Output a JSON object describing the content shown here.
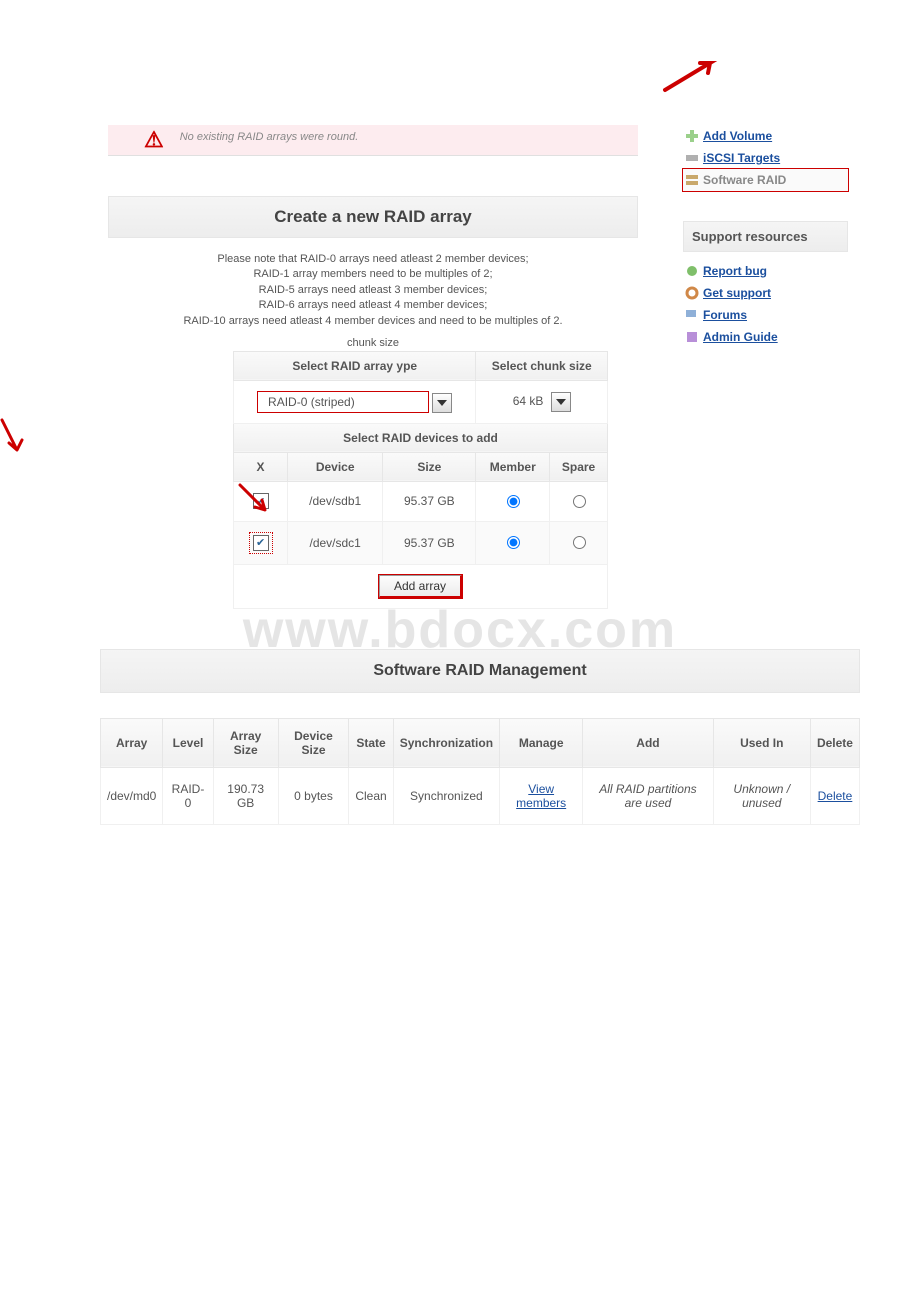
{
  "warning": {
    "message": "No existing RAID arrays were round."
  },
  "create": {
    "title": "Create a new RAID array",
    "help_lines": [
      "Please note that RAID-0 arrays need atleast 2 member devices;",
      "RAID-1 array members need to be multiples of 2;",
      "RAID-5 arrays need atleast 3 member devices;",
      "RAID-6 arrays need atleast 4 member devices;",
      "RAID-10 arrays need atleast 4 member devices and need to be multiples of 2."
    ],
    "chunk_hint": "chunk size",
    "headers": {
      "raid_type": "Select RAID array   ype",
      "chunk": "Select chunk size",
      "devices_section": "Select RAID devices to add",
      "x": "X",
      "device": "Device",
      "size": "Size",
      "member": "Member",
      "spare": "Spare"
    },
    "raid_type_value": "RAID-0 (striped)",
    "chunk_value": "64 kB",
    "devices": [
      {
        "name": "/dev/sdb1",
        "size": "95.37 GB",
        "member": true,
        "spare": false,
        "checked": true
      },
      {
        "name": "/dev/sdc1",
        "size": "95.37 GB",
        "member": true,
        "spare": false,
        "checked": true
      }
    ],
    "add_button": "Add array"
  },
  "nav": {
    "items": [
      "Add Volume",
      "iSCSI Targets",
      "Software RAID"
    ]
  },
  "support": {
    "title": "Support resources",
    "items": [
      "Report bug",
      "Get support",
      "Forums",
      "Admin Guide"
    ]
  },
  "mgmt": {
    "title": "Software RAID Management",
    "headers": {
      "array": "Array",
      "level": "Level",
      "array_size": "Array Size",
      "device_size": "Device Size",
      "state": "State",
      "sync": "Synchronization",
      "manage": "Manage",
      "add": "Add",
      "used_in": "Used In",
      "delete": "Delete"
    },
    "rows": [
      {
        "array": "/dev/md0",
        "level": "RAID-0",
        "array_size": "190.73 GB",
        "device_size": "0 bytes",
        "state": "Clean",
        "sync": "Synchronized",
        "manage": "View members",
        "add": "All RAID partitions are used",
        "used_in": "Unknown / unused",
        "delete": "Delete"
      }
    ]
  },
  "watermark_text": "www.bdocx.com"
}
